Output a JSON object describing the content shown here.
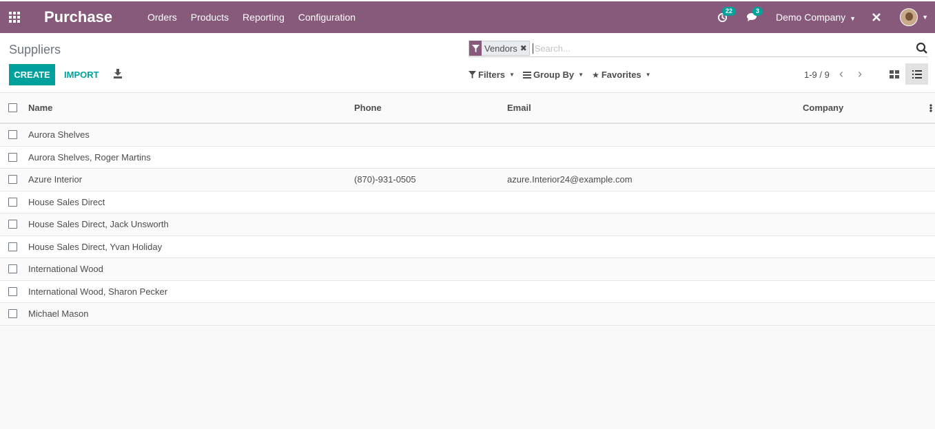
{
  "navbar": {
    "brand": "Purchase",
    "menu": [
      "Orders",
      "Products",
      "Reporting",
      "Configuration"
    ],
    "activity_count": "22",
    "message_count": "3",
    "company": "Demo Company"
  },
  "control_panel": {
    "breadcrumb": "Suppliers",
    "facet_label": "Vendors",
    "search_placeholder": "Search...",
    "create_label": "CREATE",
    "import_label": "IMPORT",
    "filters_label": "Filters",
    "group_by_label": "Group By",
    "favorites_label": "Favorites",
    "pager": "1-9 / 9"
  },
  "table": {
    "columns": [
      "Name",
      "Phone",
      "Email",
      "Company"
    ],
    "rows": [
      {
        "name": "Aurora Shelves",
        "phone": "",
        "email": "",
        "company": ""
      },
      {
        "name": "Aurora Shelves, Roger Martins",
        "phone": "",
        "email": "",
        "company": ""
      },
      {
        "name": "Azure Interior",
        "phone": "(870)-931-0505",
        "email": "azure.Interior24@example.com",
        "company": ""
      },
      {
        "name": "House Sales Direct",
        "phone": "",
        "email": "",
        "company": ""
      },
      {
        "name": "House Sales Direct, Jack Unsworth",
        "phone": "",
        "email": "",
        "company": ""
      },
      {
        "name": "House Sales Direct, Yvan Holiday",
        "phone": "",
        "email": "",
        "company": ""
      },
      {
        "name": "International Wood",
        "phone": "",
        "email": "",
        "company": ""
      },
      {
        "name": "International Wood, Sharon Pecker",
        "phone": "",
        "email": "",
        "company": ""
      },
      {
        "name": "Michael Mason",
        "phone": "",
        "email": "",
        "company": ""
      }
    ]
  },
  "colors": {
    "brand": "#875a7b",
    "accent": "#00a09d"
  },
  "icons": [
    "apps-icon",
    "activity-icon",
    "chat-icon",
    "debug-icon",
    "avatar",
    "filter-icon",
    "remove-icon",
    "search-icon",
    "download-icon",
    "list-icon",
    "star-icon",
    "kanban-icon",
    "list-view-icon",
    "chevron-left-icon",
    "chevron-right-icon",
    "optional-columns-icon"
  ]
}
